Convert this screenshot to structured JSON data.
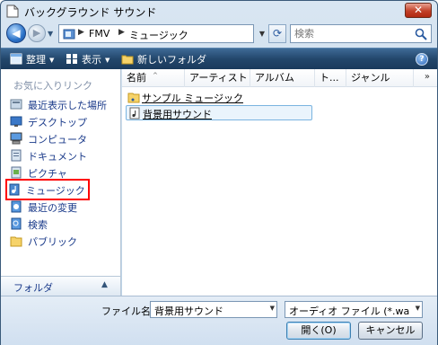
{
  "window": {
    "title": "バックグラウンド サウンド",
    "close_label": "✕"
  },
  "address": {
    "crumbs": [
      "FMV",
      "ミュージック"
    ],
    "search_placeholder": "検索"
  },
  "toolbar": {
    "organize": "整理",
    "views": "表示",
    "new_folder": "新しいフォルダ"
  },
  "nav": {
    "favorites_header": "お気に入りリンク",
    "items": [
      {
        "label": "最近表示した場所",
        "icon": "recent-places-icon"
      },
      {
        "label": "デスクトップ",
        "icon": "desktop-icon"
      },
      {
        "label": "コンピュータ",
        "icon": "computer-icon"
      },
      {
        "label": "ドキュメント",
        "icon": "documents-icon"
      },
      {
        "label": "ピクチャ",
        "icon": "pictures-icon"
      },
      {
        "label": "ミュージック",
        "icon": "music-icon"
      },
      {
        "label": "最近の変更",
        "icon": "recent-changes-icon"
      },
      {
        "label": "検索",
        "icon": "search-folder-icon"
      },
      {
        "label": "パブリック",
        "icon": "public-icon"
      }
    ],
    "highlighted_item": "ミュージック",
    "folders_label": "フォルダ"
  },
  "columns": [
    "名前",
    "アーティスト",
    "アルバム",
    "ト...",
    "ジャンル"
  ],
  "columns_more": "»",
  "files": [
    {
      "name": "サンプル ミュージック",
      "icon": "music-folder-icon",
      "selected": false
    },
    {
      "name": "背景用サウンド",
      "icon": "audio-file-icon",
      "selected": true
    }
  ],
  "bottom": {
    "filename_label": "ファイル名(N):",
    "filename_value": "背景用サウンド",
    "filetype_value": "オーディオ ファイル (*.wav;*.snd;*.au",
    "open_label": "開く(O)",
    "cancel_label": "キャンセル"
  },
  "colors": {
    "highlight_border": "#ff0000",
    "toolbar_bg": "#23476c",
    "link_text": "#1a3a8a"
  }
}
